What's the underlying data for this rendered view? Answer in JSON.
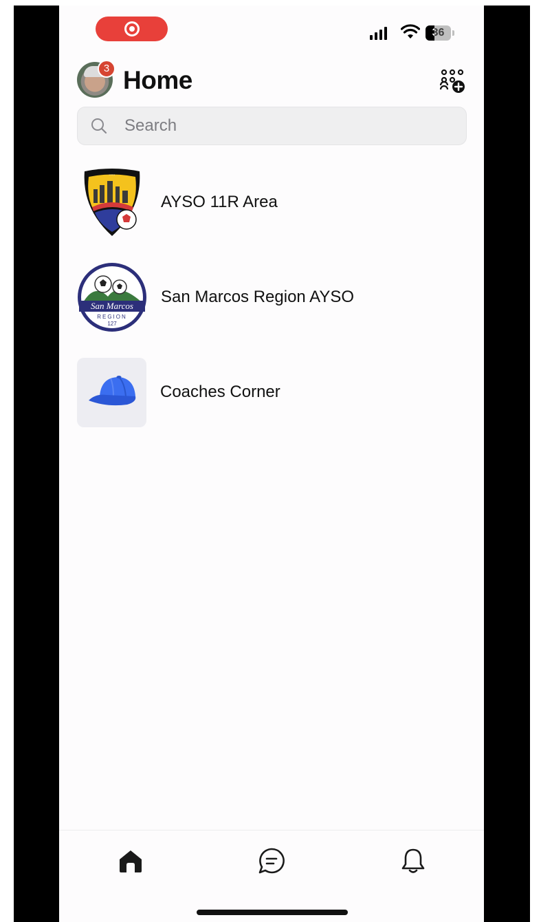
{
  "status_bar": {
    "battery_level": "36",
    "recording": true
  },
  "header": {
    "title": "Home",
    "notification_count": "3",
    "avatar_icon": "user-avatar",
    "action_icon": "community-add-icon"
  },
  "search": {
    "placeholder": "Search",
    "value": ""
  },
  "groups": [
    {
      "name": "AYSO 11R Area",
      "icon": "ayso-shield-logo"
    },
    {
      "name": "San Marcos Region AYSO",
      "icon": "san-marcos-region-logo",
      "logo_text": "San Marcos",
      "logo_subtext": "REGION",
      "logo_number": "127"
    },
    {
      "name": "Coaches Corner",
      "icon": "baseball-cap-icon"
    }
  ],
  "tabbar": {
    "active": "home",
    "tabs": [
      {
        "id": "home",
        "icon": "home-icon"
      },
      {
        "id": "chats",
        "icon": "chat-bubble-icon"
      },
      {
        "id": "notifications",
        "icon": "bell-icon"
      }
    ]
  },
  "colors": {
    "record_pill": "#e8403a",
    "badge": "#d64532",
    "cap_blue": "#3b6ef0",
    "region_navy": "#2c2f7a"
  }
}
